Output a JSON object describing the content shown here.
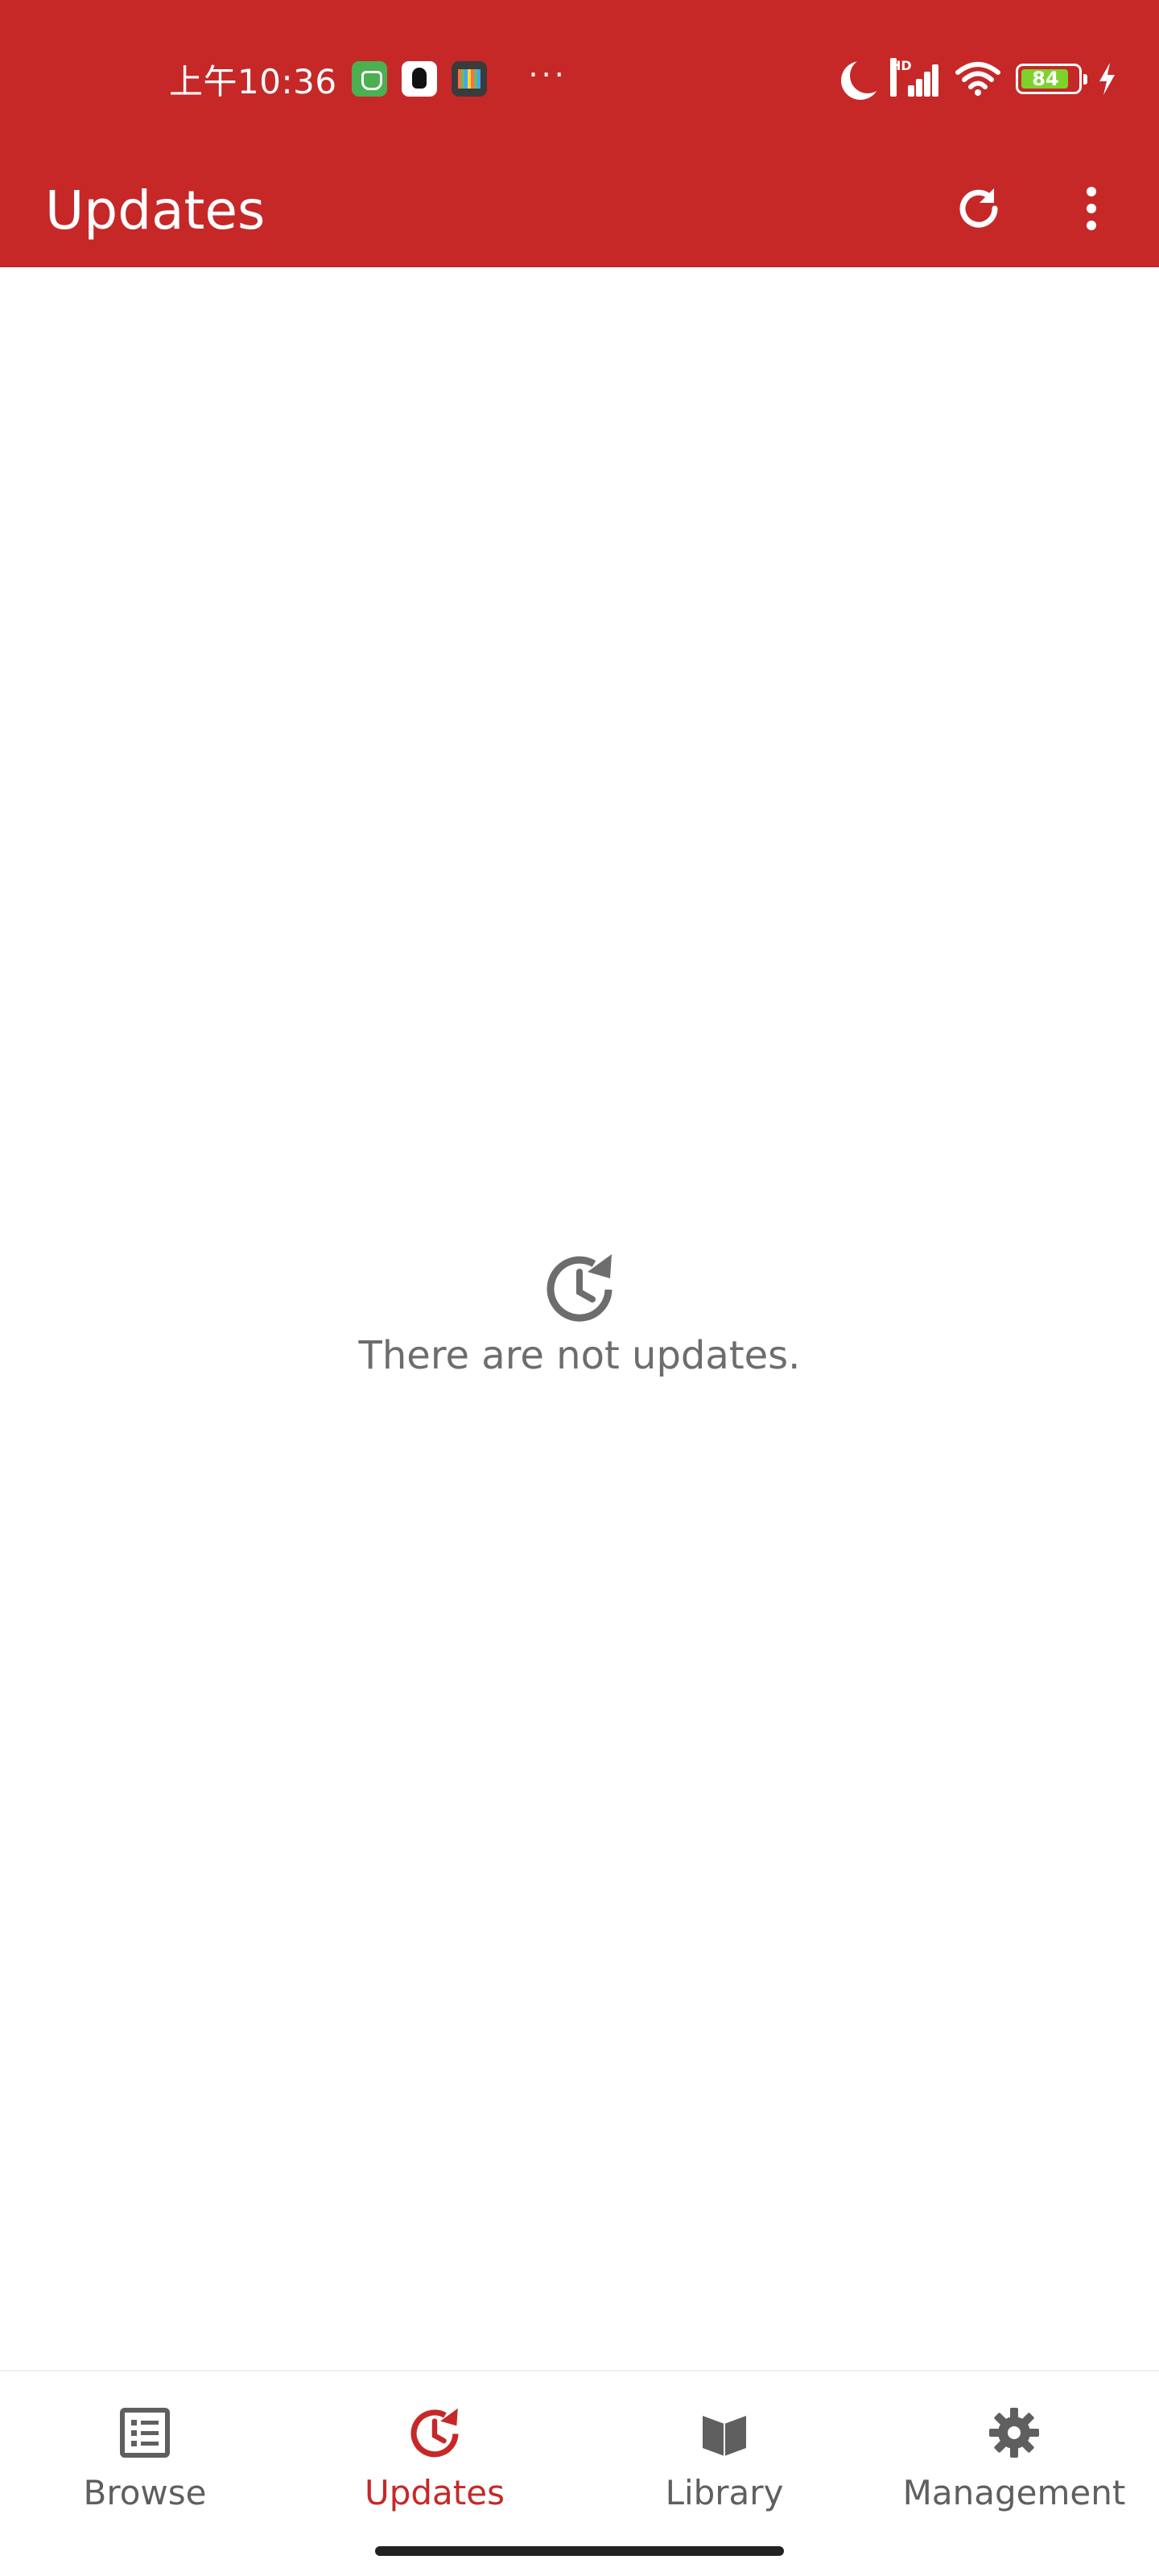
{
  "status_bar": {
    "time": "上午10:36",
    "overflow_dots": "···",
    "network_badge": "HD",
    "battery_level": "84",
    "app_icons": [
      "wechat-like-icon",
      "qq-icon",
      "reader-icon"
    ]
  },
  "app_bar": {
    "title": "Updates",
    "actions": [
      "refresh-icon",
      "more-vert-icon"
    ]
  },
  "empty_state": {
    "icon": "update-history-icon",
    "message": "There are not updates."
  },
  "bottom_nav": {
    "items": [
      {
        "label": "Browse",
        "icon": "browse-list-icon",
        "active": false
      },
      {
        "label": "Updates",
        "icon": "updates-icon",
        "active": true
      },
      {
        "label": "Library",
        "icon": "library-icon",
        "active": false
      },
      {
        "label": "Management",
        "icon": "settings-gear-icon",
        "active": false
      }
    ]
  },
  "colors": {
    "primary": "#c62828",
    "text_secondary": "#6d6d6d",
    "nav_inactive": "#5f5f5f",
    "background": "#ffffff"
  }
}
